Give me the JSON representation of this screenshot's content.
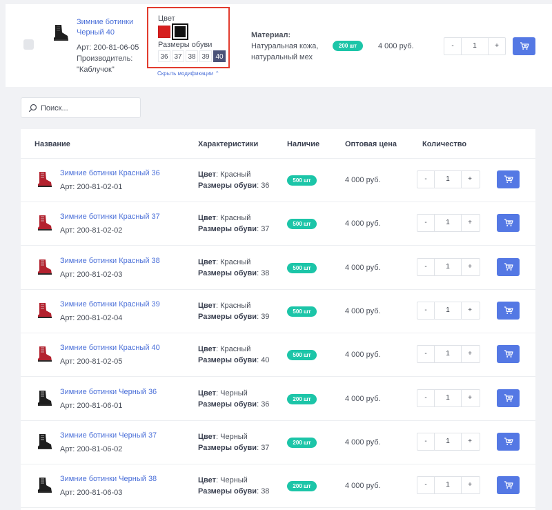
{
  "top_product": {
    "name": "Зимние ботинки Черный 40",
    "article": "Арт: 200-81-06-05",
    "producer_label": "Производитель:",
    "producer": "\"Каблучок\"",
    "color_label": "Цвет",
    "colors": [
      "#d61f1f",
      "#111111"
    ],
    "sizes_label": "Размеры обуви",
    "sizes": [
      "36",
      "37",
      "38",
      "39",
      "40"
    ],
    "active_size": "40",
    "hide_mods": "Скрыть модификации ⌃",
    "material_label": "Материал:",
    "material": "Натуральная кожа, натуральный мех",
    "stock": "200 шт",
    "price": "4 000 руб.",
    "qty_minus": "-",
    "qty_value": "1",
    "qty_plus": "+"
  },
  "search": {
    "placeholder": "Поиск..."
  },
  "table": {
    "headers": {
      "name": "Название",
      "specs": "Характеристики",
      "stock": "Наличие",
      "price": "Оптовая цена",
      "qty": "Количество"
    },
    "rows": [
      {
        "name": "Зимние ботинки Красный 36",
        "article": "Арт: 200-81-02-01",
        "color_label": "Цвет",
        "color": ": Красный",
        "size_label": "Размеры обуви",
        "size": ": 36",
        "stock": "500 шт",
        "price": "4 000 руб.",
        "qty": "1",
        "shoe": "red"
      },
      {
        "name": "Зимние ботинки Красный 37",
        "article": "Арт: 200-81-02-02",
        "color_label": "Цвет",
        "color": ": Красный",
        "size_label": "Размеры обуви",
        "size": ": 37",
        "stock": "500 шт",
        "price": "4 000 руб.",
        "qty": "1",
        "shoe": "red"
      },
      {
        "name": "Зимние ботинки Красный 38",
        "article": "Арт: 200-81-02-03",
        "color_label": "Цвет",
        "color": ": Красный",
        "size_label": "Размеры обуви",
        "size": ": 38",
        "stock": "500 шт",
        "price": "4 000 руб.",
        "qty": "1",
        "shoe": "red"
      },
      {
        "name": "Зимние ботинки Красный 39",
        "article": "Арт: 200-81-02-04",
        "color_label": "Цвет",
        "color": ": Красный",
        "size_label": "Размеры обуви",
        "size": ": 39",
        "stock": "500 шт",
        "price": "4 000 руб.",
        "qty": "1",
        "shoe": "red"
      },
      {
        "name": "Зимние ботинки Красный 40",
        "article": "Арт: 200-81-02-05",
        "color_label": "Цвет",
        "color": ": Красный",
        "size_label": "Размеры обуви",
        "size": ": 40",
        "stock": "500 шт",
        "price": "4 000 руб.",
        "qty": "1",
        "shoe": "red"
      },
      {
        "name": "Зимние ботинки Черный 36",
        "article": "Арт: 200-81-06-01",
        "color_label": "Цвет",
        "color": ": Черный",
        "size_label": "Размеры обуви",
        "size": ": 36",
        "stock": "200 шт",
        "price": "4 000 руб.",
        "qty": "1",
        "shoe": "black"
      },
      {
        "name": "Зимние ботинки Черный 37",
        "article": "Арт: 200-81-06-02",
        "color_label": "Цвет",
        "color": ": Черный",
        "size_label": "Размеры обуви",
        "size": ": 37",
        "stock": "200 шт",
        "price": "4 000 руб.",
        "qty": "1",
        "shoe": "black"
      },
      {
        "name": "Зимние ботинки Черный 38",
        "article": "Арт: 200-81-06-03",
        "color_label": "Цвет",
        "color": ": Черный",
        "size_label": "Размеры обуви",
        "size": ": 38",
        "stock": "200 шт",
        "price": "4 000 руб.",
        "qty": "1",
        "shoe": "black"
      }
    ],
    "qty_minus": "-",
    "qty_plus": "+"
  },
  "colors": {
    "accent": "#5478e4",
    "link": "#4a6fd8",
    "stock_badge": "#1cc5a8",
    "shoe_red": "#b3222f",
    "shoe_black": "#1e1e1e",
    "highlight_border": "#e23b2e"
  },
  "icons": {
    "cart": "cart-icon",
    "search": "search-icon",
    "shoe": "boot-icon"
  }
}
